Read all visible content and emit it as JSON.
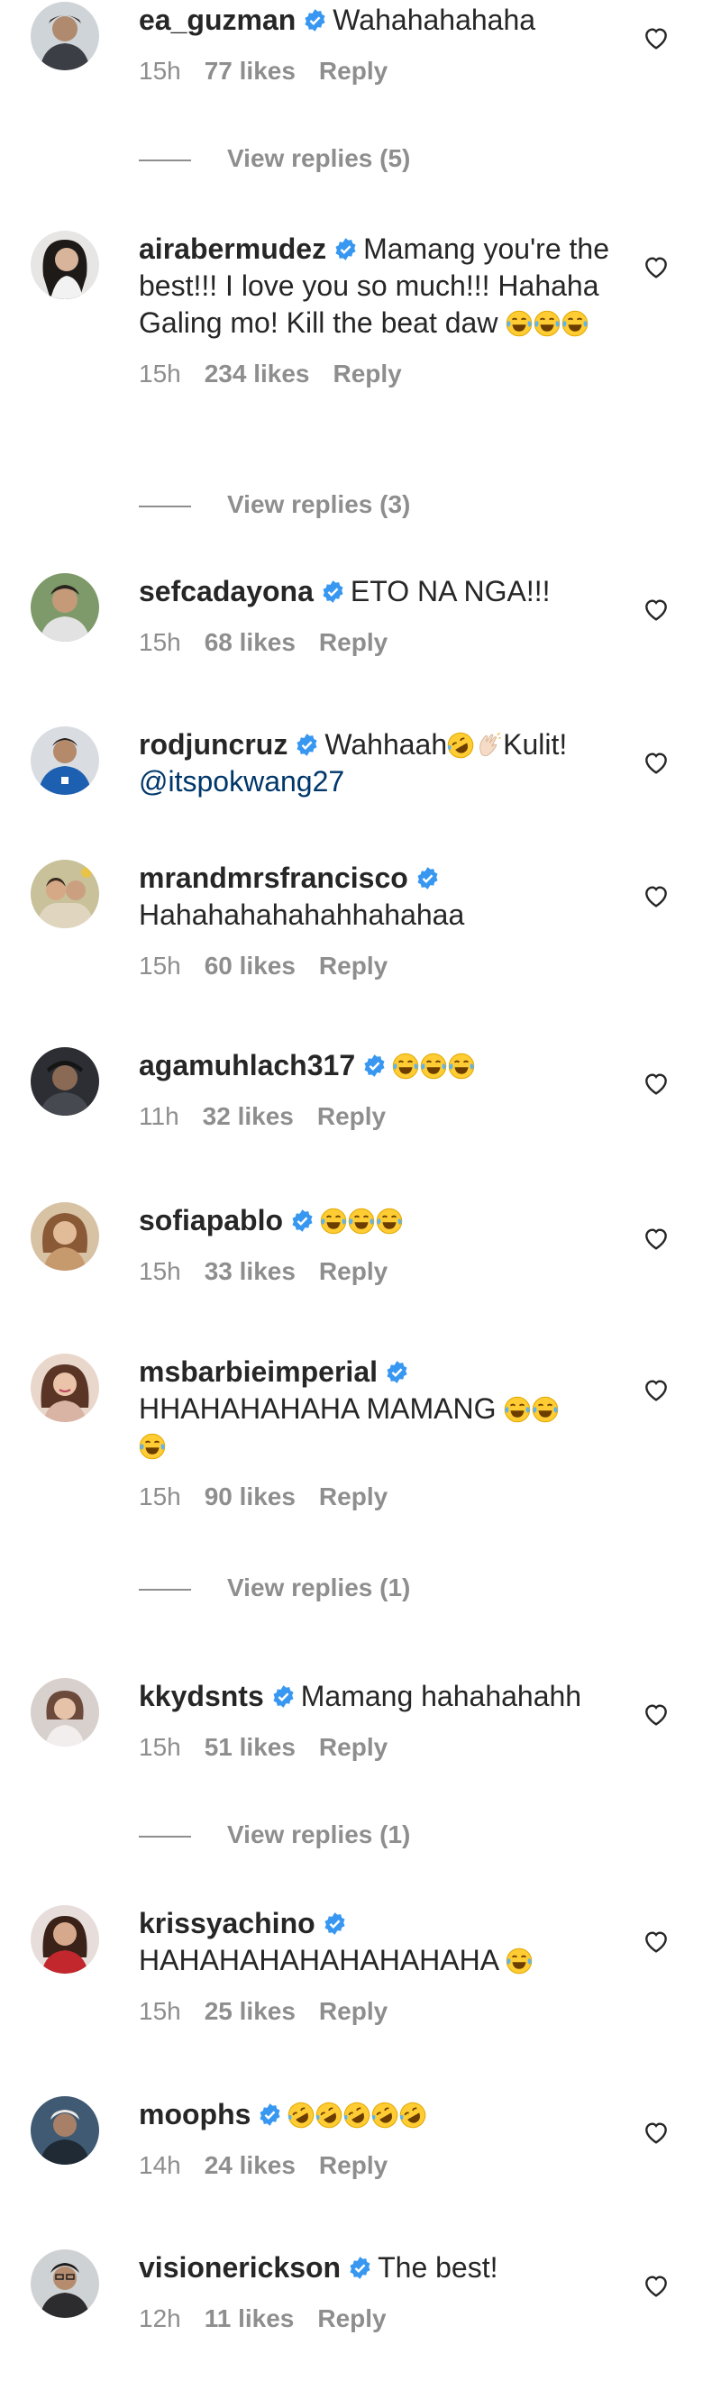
{
  "colors": {
    "text": "#262626",
    "muted": "#8e8e8e",
    "verified": "#3897f0",
    "mention": "#00376b"
  },
  "comments": [
    {
      "username": "ea_guzman",
      "text": "Wahahahahaha",
      "time": "15h",
      "likes": "77 likes",
      "reply": "Reply",
      "view_replies": "View replies (5)"
    },
    {
      "username": "airabermudez",
      "text": "Mamang you're the best!!! I love you so much!!! Hahaha Galing mo! Kill the beat daw",
      "emojis": [
        "face-with-tears-of-joy",
        "face-with-tears-of-joy",
        "face-with-tears-of-joy"
      ],
      "time": "15h",
      "likes": "234 likes",
      "reply": "Reply",
      "view_replies": "View replies (3)"
    },
    {
      "username": "sefcadayona",
      "text": "ETO NA NGA!!!",
      "time": "15h",
      "likes": "68 likes",
      "reply": "Reply"
    },
    {
      "username": "rodjuncruz",
      "text": "Wahhaah",
      "emojis": [
        "rolling-on-floor-laughing",
        "clapping-hands"
      ],
      "text2": "Kulit!",
      "mention": "@itspokwang27"
    },
    {
      "username": "mrandmrsfrancisco",
      "text": "Hahahahahahahhahahaa",
      "time": "15h",
      "likes": "60 likes",
      "reply": "Reply"
    },
    {
      "username": "agamuhlach317",
      "text": "",
      "emojis": [
        "face-with-tears-of-joy",
        "face-with-tears-of-joy",
        "face-with-tears-of-joy"
      ],
      "time": "11h",
      "likes": "32 likes",
      "reply": "Reply"
    },
    {
      "username": "sofiapablo",
      "text": "",
      "emojis": [
        "face-with-tears-of-joy",
        "face-with-tears-of-joy",
        "face-with-tears-of-joy"
      ],
      "time": "15h",
      "likes": "33 likes",
      "reply": "Reply"
    },
    {
      "username": "msbarbieimperial",
      "text": "HHAHAHAHAHA MAMANG",
      "emojis": [
        "face-with-tears-of-joy",
        "face-with-tears-of-joy",
        "face-with-tears-of-joy"
      ],
      "time": "15h",
      "likes": "90 likes",
      "reply": "Reply",
      "view_replies": "View replies (1)"
    },
    {
      "username": "kkydsnts",
      "text": "Mamang hahahahahh",
      "time": "15h",
      "likes": "51 likes",
      "reply": "Reply",
      "view_replies": "View replies (1)"
    },
    {
      "username": "krissyachino",
      "text": "HAHAHAHAHAHAHAHAHA",
      "emojis": [
        "face-with-tears-of-joy"
      ],
      "time": "15h",
      "likes": "25 likes",
      "reply": "Reply"
    },
    {
      "username": "moophs",
      "text": "",
      "emojis": [
        "rolling-on-floor-laughing",
        "rolling-on-floor-laughing",
        "rolling-on-floor-laughing",
        "rolling-on-floor-laughing",
        "rolling-on-floor-laughing"
      ],
      "time": "14h",
      "likes": "24 likes",
      "reply": "Reply"
    },
    {
      "username": "visionerickson",
      "text": "The best!",
      "time": "12h",
      "likes": "11 likes",
      "reply": "Reply"
    }
  ]
}
